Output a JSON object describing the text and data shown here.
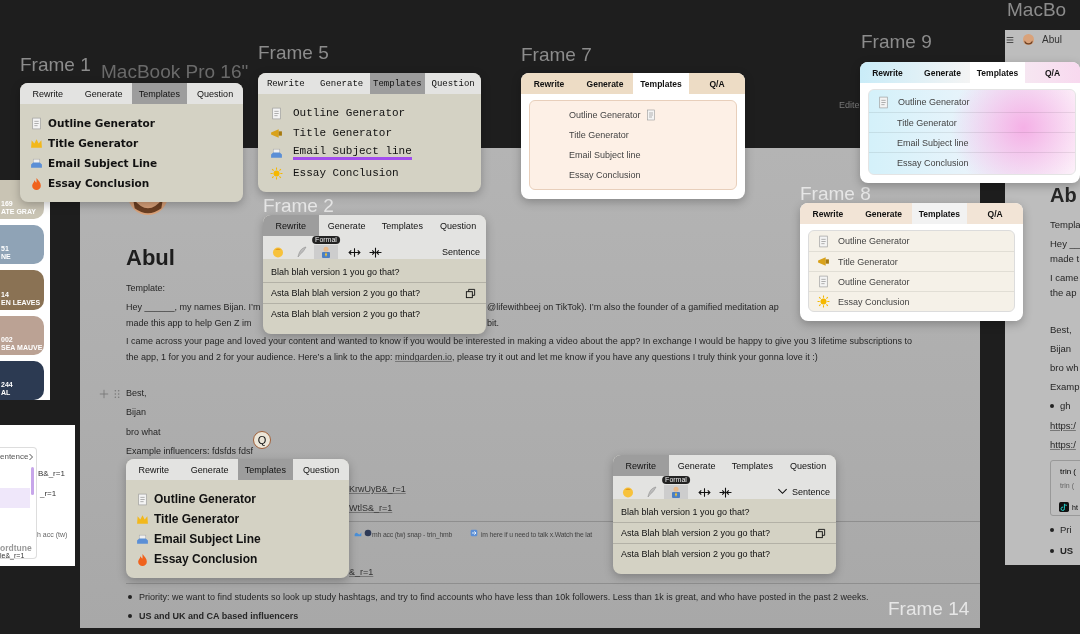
{
  "frame_labels": [
    "Frame 1",
    "MacBook Pro 16\"",
    "Frame 5",
    "Frame 7",
    "Frame 9",
    "Frame 8",
    "Frame 2",
    "Frame 14",
    "MacBo"
  ],
  "swatches": [
    {
      "color": "#c9c4b4",
      "code": "169",
      "name": "ATE GRAY"
    },
    {
      "color": "#8fa3b6",
      "code": "51",
      "name": "NE"
    },
    {
      "color": "#8a7254",
      "code": "14",
      "name": "EN LEAVES"
    },
    {
      "color": "#bba294",
      "code": "002",
      "name": "SEA MAUVE"
    },
    {
      "color": "#2c3a52",
      "code": "244",
      "name": "AL"
    }
  ],
  "side_menu": {
    "header": "entence",
    "footer": "ordtune",
    "texts": [
      "B&_r=1",
      "_r=1",
      "h acc (tw)",
      "le&_r=1"
    ]
  },
  "document": {
    "title": "Abul",
    "edited": "Edite",
    "lines": [
      {
        "kind": "text",
        "text": "Template:"
      },
      {
        "kind": "text",
        "text": "Hey ______, my names Bijan. I’m"
      },
      {
        "kind": "text",
        "text": "@lifewithbeej on TikTok). I’m also the founder of a gamified meditation ap"
      },
      {
        "kind": "text",
        "text": "made this app to help Gen Z im"
      },
      {
        "kind": "text",
        "text": "bit."
      },
      {
        "kind": "text",
        "text": "I came across your page and loved your content and wanted to know if you would be interested in making a video about the app? In exchange I would be happy to give you 3 lifetime subscriptions to"
      },
      {
        "kind": "mixed",
        "parts": [
          {
            "kind": "text",
            "text": "the app, 1 for you and 2 for your audience.  Here’s a link to the app: "
          },
          {
            "kind": "link",
            "text": "mindgarden.io"
          },
          {
            "kind": "text",
            "text": ", please try it out and let me know if you have any questions I truly think your gonna love it :)"
          }
        ]
      },
      {
        "kind": "text",
        "text": "Best,"
      },
      {
        "kind": "text",
        "text": "Bijan"
      },
      {
        "kind": "text",
        "text": "bro what"
      },
      {
        "kind": "text",
        "text": "Example influencers: fdsfds fdsf"
      },
      {
        "kind": "link",
        "text": "KrwUyB&_r=1"
      },
      {
        "kind": "link",
        "text": "WtlS&_r=1"
      },
      {
        "kind": "small",
        "text": "mh acc (tw) snap - trin_hmb"
      },
      {
        "kind": "small",
        "text": "im here if u need to talk x.Watch the lat"
      },
      {
        "kind": "link",
        "text": "&_r=1"
      },
      {
        "kind": "bullet",
        "text": "Priority: we want to find students so look up study hashtags, and try to find accounts who have less than 10k followers. Less than 1k is great, and who have posted in the past 2 weeks."
      },
      {
        "kind": "bullet-bold",
        "text": "US and UK and CA based influencers"
      }
    ]
  },
  "side_doc": {
    "header": "Abul",
    "lines": [
      {
        "kind": "heading",
        "text": "Ab"
      },
      {
        "kind": "text",
        "text": "Templa"
      },
      {
        "kind": "text",
        "text": "Hey __"
      },
      {
        "kind": "text",
        "text": "made t"
      },
      {
        "kind": "text",
        "text": "I came"
      },
      {
        "kind": "text",
        "text": "the ap"
      },
      {
        "kind": "text",
        "text": "Best,"
      },
      {
        "kind": "text",
        "text": "Bijan"
      },
      {
        "kind": "text",
        "text": "bro wh"
      },
      {
        "kind": "text",
        "text": "Examp"
      },
      {
        "kind": "bullet",
        "text": "gh"
      },
      {
        "kind": "link",
        "text": "https:/"
      },
      {
        "kind": "link",
        "text": "https:/"
      },
      {
        "kind": "bullet",
        "text": "Pri"
      },
      {
        "kind": "bullet-bold",
        "text": "US"
      }
    ],
    "card": [
      "trin (",
      "trin (",
      "ht"
    ]
  },
  "badge": "Q",
  "popups": [
    {
      "kind": "rounded",
      "tabs": [
        {
          "label": "Rewrite",
          "selected": false
        },
        {
          "label": "Generate",
          "selected": false
        },
        {
          "label": "Templates",
          "selected": true
        },
        {
          "label": "Question",
          "selected": false
        }
      ],
      "items": [
        {
          "label": "Outline Generator"
        },
        {
          "label": "Title Generator"
        },
        {
          "label": "Email Subject Line"
        },
        {
          "label": "Essay Conclusion"
        }
      ]
    },
    {
      "kind": "mono",
      "tabs": [
        {
          "label": "Rewrite",
          "selected": false
        },
        {
          "label": "Generate",
          "selected": false
        },
        {
          "label": "Templates",
          "selected": true
        },
        {
          "label": "Question",
          "selected": false
        }
      ],
      "items": [
        {
          "label": "Outline Generator",
          "highlighted": false
        },
        {
          "label": "Title Generator",
          "highlighted": false
        },
        {
          "label": "Email Subject line",
          "highlighted": true
        },
        {
          "label": "Essay Conclusion",
          "highlighted": false
        }
      ]
    },
    {
      "kind": "peach",
      "tabs": [
        {
          "label": "Rewrite",
          "selected": false
        },
        {
          "label": "Generate",
          "selected": false
        },
        {
          "label": "Templates",
          "selected": true
        },
        {
          "label": "Q/A",
          "selected": false
        }
      ],
      "items": [
        {
          "label": "Outline Generator"
        },
        {
          "label": "Title Generator"
        },
        {
          "label": "Email Subject line"
        },
        {
          "label": "Essay Conclusion"
        }
      ]
    },
    {
      "kind": "gradient",
      "tabs": [
        {
          "label": "Rewrite",
          "selected": false
        },
        {
          "label": "Generate",
          "selected": false
        },
        {
          "label": "Templates",
          "selected": true
        },
        {
          "label": "Q/A",
          "selected": false
        }
      ],
      "items": [
        {
          "label": "Outline Generator"
        },
        {
          "label": "Title Generator"
        },
        {
          "label": "Email Subject line"
        },
        {
          "label": "Essay Conclusion"
        }
      ]
    },
    {
      "kind": "cream",
      "tabs": [
        {
          "label": "Rewrite",
          "selected": false
        },
        {
          "label": "Generate",
          "selected": false
        },
        {
          "label": "Templates",
          "selected": true
        },
        {
          "label": "Q/A",
          "selected": false
        }
      ],
      "items": [
        {
          "label": "Outline Generator"
        },
        {
          "label": "Title Generator"
        },
        {
          "label": "Outline Generator"
        },
        {
          "label": "Essay Conclusion"
        }
      ]
    },
    {
      "kind": "rewrite",
      "tabs": [
        {
          "label": "Rewrite",
          "selected": true
        },
        {
          "label": "Generate",
          "selected": false
        },
        {
          "label": "Templates",
          "selected": false
        },
        {
          "label": "Question",
          "selected": false
        }
      ],
      "tones": [
        {
          "selected": false
        },
        {
          "selected": false
        },
        {
          "selected": true
        }
      ],
      "tooltip": "Formal",
      "length": "Sentence",
      "chevron": false,
      "options": [
        {
          "text": "Blah blah version 1 you go that?",
          "hovered": false
        },
        {
          "text": "Asta Blah blah version 2 you go that?",
          "hovered": true
        },
        {
          "text": "Asta Blah blah version 2 you go that?",
          "hovered": false
        }
      ]
    },
    {
      "kind": "bold",
      "tabs": [
        {
          "label": "Rewrite",
          "selected": false
        },
        {
          "label": "Generate",
          "selected": false
        },
        {
          "label": "Templates",
          "selected": true
        },
        {
          "label": "Question",
          "selected": false
        }
      ],
      "items": [
        {
          "label": "Outline Generator"
        },
        {
          "label": "Title Generator"
        },
        {
          "label": "Email Subject Line"
        },
        {
          "label": "Essay Conclusion"
        }
      ]
    },
    {
      "kind": "rewrite",
      "tabs": [
        {
          "label": "Rewrite",
          "selected": true
        },
        {
          "label": "Generate",
          "selected": false
        },
        {
          "label": "Templates",
          "selected": false
        },
        {
          "label": "Question",
          "selected": false
        }
      ],
      "tones": [
        {
          "selected": false
        },
        {
          "selected": false
        },
        {
          "selected": true
        }
      ],
      "tooltip": "Formal",
      "length": "Sentence",
      "chevron": true,
      "options": [
        {
          "text": "Blah blah version 1 you go that?",
          "hovered": false
        },
        {
          "text": "Asta Blah blah version 2 you go that?",
          "hovered": true
        },
        {
          "text": "Asta Blah blah version 2 you go that?",
          "hovered": false
        }
      ]
    }
  ]
}
